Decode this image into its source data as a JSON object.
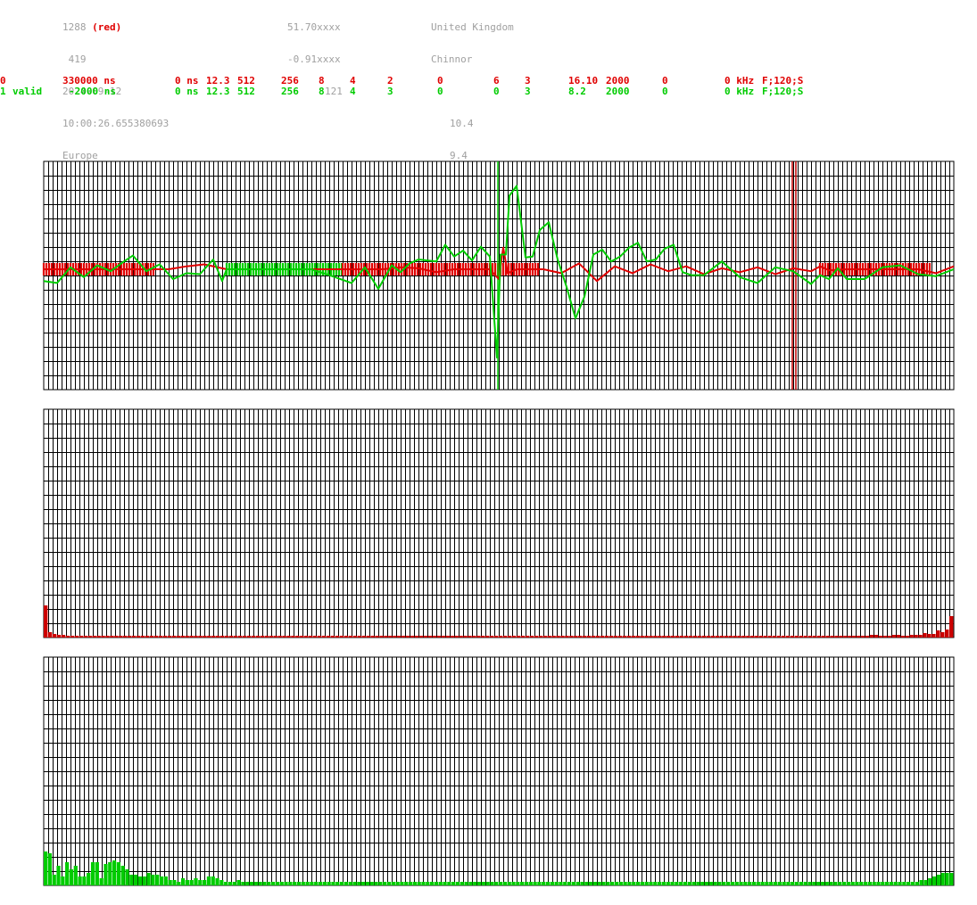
{
  "header": {
    "station_id": "1288",
    "station_color_note": "(red)",
    "field_419": "419",
    "date": "2024-09-12",
    "time": "10:00:26.655380693",
    "region": "Europe",
    "lat": "51.70xxxx",
    "lon": "-0.91xxxx",
    "alt": "121",
    "country": "United Kingdom",
    "city": "Chinnor",
    "val_a": "10.4",
    "val_b": "9.4"
  },
  "channels": [
    {
      "color": "#e00000",
      "id": "0",
      "status": "",
      "delay": "330000 ns",
      "offset": "0 ns",
      "f1": "12.3",
      "f2": "512",
      "f3": "256",
      "f4": "8",
      "f5": "4",
      "f6": "2",
      "f7": "0",
      "f8": "6",
      "f9": "3",
      "f10": "16.10",
      "f11": "2000",
      "f12": "0",
      "freq": "0 kHz",
      "mode": "F;120;S"
    },
    {
      "color": "#00cc00",
      "id": "1",
      "status": "valid",
      "delay": "-2000 ns",
      "offset": "0 ns",
      "f1": "12.3",
      "f2": "512",
      "f3": "256",
      "f4": "8",
      "f5": "4",
      "f6": "3",
      "f7": "0",
      "f8": "0",
      "f9": "3",
      "f10": "8.2",
      "f11": "2000",
      "f12": "0",
      "freq": "0 kHz",
      "mode": "F;120;S"
    }
  ],
  "chart_data": [
    {
      "type": "line",
      "description_tag": "waveform",
      "series": [
        {
          "color": "#e00000",
          "x": [
            0,
            20,
            40,
            60,
            80,
            100,
            120,
            140,
            160,
            180,
            200,
            205,
            210,
            220,
            240,
            260,
            280,
            300,
            320,
            340,
            360,
            380,
            400,
            420,
            440,
            460,
            480,
            500,
            510,
            515,
            520,
            530,
            560,
            580,
            600,
            620,
            640,
            660,
            680,
            700,
            720,
            740,
            760,
            780,
            800,
            820,
            840,
            860,
            870,
            880,
            900,
            920,
            940,
            960,
            980,
            1000,
            1020
          ],
          "values": [
            0,
            0,
            0,
            0,
            0,
            0,
            0,
            0,
            0.3,
            0.5,
            0.1,
            0,
            0,
            0,
            0,
            0,
            0,
            0,
            0,
            0,
            0,
            0,
            0.2,
            0.1,
            -0.3,
            0,
            0,
            0,
            -1.0,
            2.2,
            -0.4,
            0,
            0,
            -0.4,
            0.6,
            -1.2,
            0.3,
            -0.4,
            0.5,
            -0.2,
            0.3,
            -0.5,
            0.1,
            -0.3,
            0.2,
            -0.5,
            0.1,
            -0.2,
            0.3,
            -0.1,
            0,
            0,
            0,
            0,
            0,
            -0.4,
            0.3
          ]
        },
        {
          "color": "#00cc00",
          "x": [
            0,
            15,
            30,
            45,
            60,
            75,
            90,
            100,
            115,
            130,
            145,
            160,
            175,
            190,
            200,
            205,
            260,
            300,
            320,
            345,
            360,
            375,
            390,
            400,
            410,
            420,
            440,
            450,
            460,
            470,
            480,
            490,
            500,
            508,
            512,
            518,
            522,
            530,
            540,
            548,
            556,
            566,
            576,
            586,
            596,
            606,
            616,
            626,
            636,
            646,
            656,
            666,
            676,
            686,
            696,
            706,
            716,
            726,
            740,
            760,
            780,
            800,
            820,
            840,
            860,
            870,
            880,
            890,
            900,
            920,
            940,
            960,
            980,
            1000,
            1020
          ],
          "values": [
            -1.2,
            -1.4,
            0.2,
            -0.8,
            0.4,
            -0.2,
            0.8,
            1.4,
            -0.2,
            0.5,
            -1.0,
            -0.4,
            -0.5,
            1.0,
            -1.2,
            0,
            0,
            0,
            -0.6,
            -1.4,
            0.2,
            -2.0,
            0.4,
            -0.3,
            0.6,
            1.0,
            0.8,
            2.5,
            1.3,
            1.9,
            0.9,
            2.3,
            1.3,
            -9.0,
            1.5,
            1.5,
            7.5,
            8.5,
            1.2,
            1.3,
            4.0,
            4.8,
            1.0,
            -1.8,
            -5.0,
            -2.8,
            1.5,
            2.0,
            0.8,
            1.3,
            2.2,
            2.7,
            0.8,
            1.0,
            2.1,
            2.5,
            -0.3,
            -0.6,
            -0.6,
            0.8,
            -0.8,
            -1.4,
            0.2,
            -0.2,
            -1.5,
            -0.6,
            -1.0,
            0.1,
            -1.0,
            -1.0,
            0.2,
            0.4,
            -0.5,
            -0.7,
            0
          ]
        }
      ],
      "markers": [
        {
          "x": 509,
          "color": "#00cc00"
        },
        {
          "x": 839,
          "color": "#c00000"
        },
        {
          "x": 843,
          "color": "#c00000"
        }
      ],
      "dense_bands": [
        {
          "x_start": 0,
          "x_end": 125,
          "color": "#e00000"
        },
        {
          "x_start": 205,
          "x_end": 335,
          "color": "#00cc00"
        },
        {
          "x_start": 335,
          "x_end": 555,
          "color": "#e00000"
        },
        {
          "x_start": 870,
          "x_end": 995,
          "color": "#e00000"
        }
      ],
      "xlim": [
        0,
        1020
      ],
      "ylim": [
        -10,
        10
      ]
    },
    {
      "type": "bar",
      "description_tag": "spectrum",
      "color": "#cc0000",
      "values": [
        36,
        6,
        4,
        3,
        3,
        2,
        2,
        2,
        2,
        2,
        2,
        2,
        2,
        2,
        2,
        2,
        2,
        2,
        2,
        2,
        2,
        2,
        2,
        2,
        2,
        2,
        2,
        2,
        2,
        2,
        2,
        2,
        2,
        2,
        2,
        2,
        2,
        2,
        2,
        2,
        2,
        2,
        2,
        2,
        2,
        2,
        2,
        2,
        2,
        2,
        2,
        2,
        2,
        2,
        2,
        2,
        2,
        2,
        2,
        2,
        2,
        2,
        2,
        2,
        2,
        2,
        2,
        2,
        2,
        2,
        2,
        2,
        2,
        2,
        2,
        2,
        2,
        2,
        2,
        2,
        2,
        2,
        2,
        2,
        2,
        2,
        2,
        2,
        2,
        2,
        2,
        2,
        2,
        2,
        2,
        2,
        2,
        2,
        2,
        2,
        2,
        2,
        2,
        2,
        2,
        2,
        2,
        2,
        2,
        2,
        2,
        2,
        2,
        2,
        2,
        2,
        2,
        2,
        2,
        2,
        2,
        2,
        2,
        2,
        2,
        2,
        2,
        2,
        2,
        2,
        2,
        2,
        2,
        2,
        2,
        2,
        2,
        2,
        2,
        2,
        2,
        2,
        2,
        2,
        2,
        2,
        2,
        2,
        2,
        2,
        2,
        2,
        2,
        2,
        2,
        2,
        2,
        2,
        2,
        2,
        2,
        2,
        2,
        2,
        2,
        2,
        2,
        2,
        2,
        2,
        2,
        2,
        2,
        2,
        2,
        2,
        2,
        2,
        2,
        2,
        2,
        2,
        2,
        2,
        2,
        2,
        2,
        3,
        3,
        2,
        2,
        2,
        3,
        3,
        2,
        2,
        3,
        3,
        3,
        5,
        4,
        4,
        8,
        6,
        9,
        24
      ],
      "ylim": [
        0,
        256
      ]
    },
    {
      "type": "bar",
      "description_tag": "spectrum",
      "color": "#00cc00",
      "values": [
        38,
        36,
        12,
        22,
        10,
        26,
        18,
        22,
        10,
        10,
        14,
        26,
        26,
        8,
        24,
        26,
        28,
        26,
        22,
        18,
        12,
        12,
        10,
        10,
        14,
        12,
        12,
        10,
        10,
        6,
        6,
        4,
        8,
        6,
        6,
        8,
        6,
        6,
        10,
        10,
        8,
        6,
        4,
        4,
        4,
        6,
        4,
        4,
        4,
        4,
        4,
        4,
        4,
        4,
        4,
        4,
        4,
        4,
        4,
        4,
        4,
        4,
        4,
        4,
        4,
        4,
        4,
        4,
        4,
        4,
        4,
        4,
        4,
        4,
        4,
        4,
        4,
        4,
        4,
        4,
        4,
        4,
        4,
        4,
        4,
        4,
        4,
        4,
        4,
        4,
        4,
        4,
        4,
        4,
        4,
        4,
        4,
        4,
        4,
        4,
        4,
        4,
        4,
        4,
        4,
        4,
        4,
        4,
        4,
        4,
        4,
        4,
        4,
        4,
        4,
        4,
        4,
        4,
        4,
        4,
        4,
        4,
        4,
        4,
        4,
        4,
        4,
        4,
        4,
        4,
        4,
        4,
        4,
        4,
        4,
        4,
        4,
        4,
        4,
        4,
        4,
        4,
        4,
        4,
        4,
        4,
        4,
        4,
        4,
        4,
        4,
        4,
        4,
        4,
        4,
        4,
        4,
        4,
        4,
        4,
        4,
        4,
        4,
        4,
        4,
        4,
        4,
        4,
        4,
        4,
        4,
        4,
        4,
        4,
        4,
        4,
        4,
        4,
        4,
        4,
        4,
        4,
        4,
        4,
        4,
        4,
        4,
        4,
        4,
        4,
        4,
        4,
        4,
        4,
        4,
        4,
        4,
        4,
        4,
        4,
        4,
        4,
        4,
        4,
        6,
        6,
        8,
        10,
        12,
        14,
        14,
        14
      ],
      "ylim": [
        0,
        256
      ]
    }
  ]
}
